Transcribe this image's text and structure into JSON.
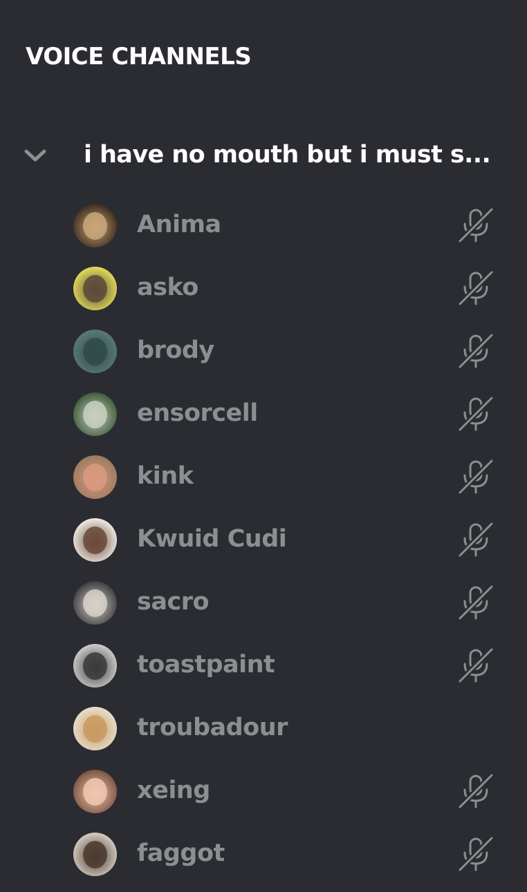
{
  "section": {
    "title": "VOICE CHANNELS"
  },
  "channel": {
    "name": "i have no mouth but i must s...",
    "expand_icon": "chevron-down-icon"
  },
  "users": [
    {
      "name": "Anima",
      "muted": true,
      "avatar_colors": [
        "#3a2a1e",
        "#c9a77a"
      ]
    },
    {
      "name": "asko",
      "muted": true,
      "avatar_colors": [
        "#e6df5a",
        "#5a4a3a"
      ]
    },
    {
      "name": "brody",
      "muted": true,
      "avatar_colors": [
        "#5b7a78",
        "#2f4a48"
      ]
    },
    {
      "name": "ensorcell",
      "muted": true,
      "avatar_colors": [
        "#3f5a3a",
        "#c8d0c0"
      ]
    },
    {
      "name": "kink",
      "muted": true,
      "avatar_colors": [
        "#9a7a60",
        "#d99a80"
      ]
    },
    {
      "name": "Kwuid Cudi",
      "muted": true,
      "avatar_colors": [
        "#f2efe9",
        "#6a4a3a"
      ]
    },
    {
      "name": "sacro",
      "muted": true,
      "avatar_colors": [
        "#3a3a40",
        "#d8d2c8"
      ]
    },
    {
      "name": "toastpaint",
      "muted": true,
      "avatar_colors": [
        "#d0d0d0",
        "#3a3a3a"
      ]
    },
    {
      "name": "troubadour",
      "muted": false,
      "avatar_colors": [
        "#e8e0d0",
        "#c99a60"
      ]
    },
    {
      "name": "xeing",
      "muted": true,
      "avatar_colors": [
        "#7a5040",
        "#f0c8b0"
      ]
    },
    {
      "name": "faggot",
      "muted": true,
      "avatar_colors": [
        "#d8cfc4",
        "#4a3a2e"
      ]
    }
  ],
  "colors": {
    "background": "#2a2c31",
    "header_text": "#ffffff",
    "username_text": "#8d8e91",
    "icon": "#8d8e91"
  },
  "icons": {
    "mute": "mic-muted-icon",
    "chevron": "chevron-down-icon"
  }
}
